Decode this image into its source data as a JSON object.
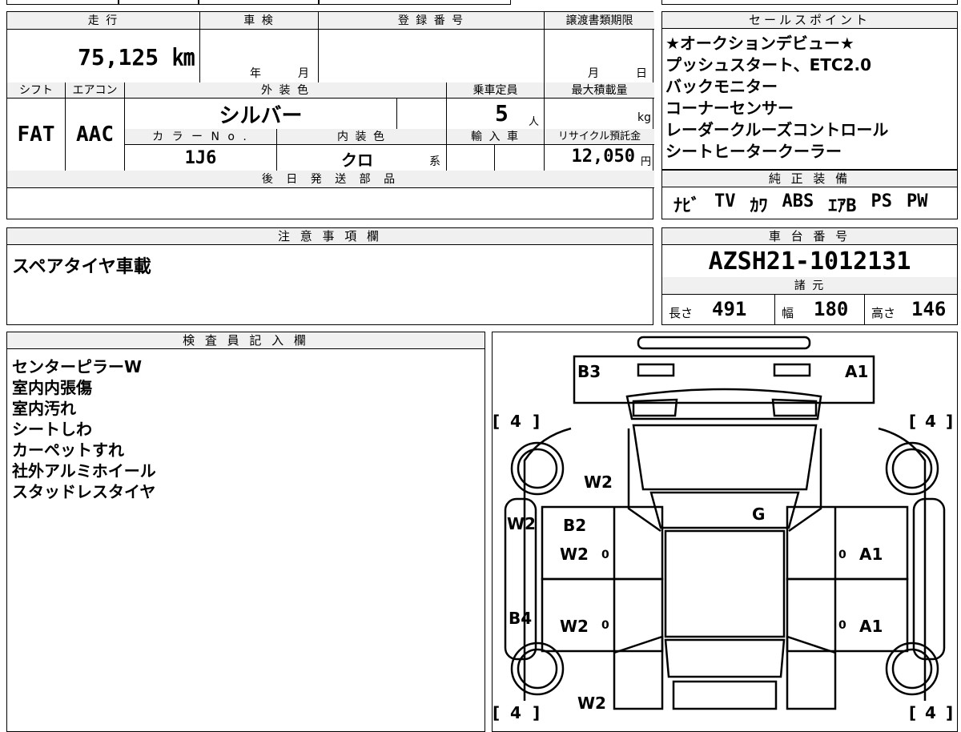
{
  "vehicle": {
    "mileage_label": "走 行",
    "mileage": "75,125 ㎞",
    "inspection_label": "車 検",
    "inspection_year": "年",
    "inspection_month": "月",
    "registration_label": "登 録 番 号",
    "deadline_label": "譲渡書類期限",
    "deadline_month": "月",
    "deadline_day": "日",
    "shift_label": "シフト",
    "shift": "FAT",
    "aircon_label": "エアコン",
    "aircon": "AAC",
    "exterior_color_label": "外 装 色",
    "exterior_color": "シルバー",
    "capacity_label": "乗車定員",
    "capacity": "5",
    "capacity_unit": "人",
    "max_load_label": "最大積載量",
    "max_load_unit": "kg",
    "color_no_label": "カ ラ ー N o .",
    "color_no": "1J6",
    "interior_color_label": "内 装 色",
    "interior_color": "クロ",
    "interior_color_suffix": "系",
    "import_label": "輸 入 車",
    "recycle_label": "リサイクル預託金",
    "recycle_fee": "12,050",
    "recycle_unit": "円",
    "later_parts_label": "後 日 発 送 部 品"
  },
  "sales_points": {
    "title": "セールスポイント",
    "items": [
      "★オークションデビュー★",
      "プッシュスタート、ETC2.0",
      "バックモニター",
      "コーナーセンサー",
      "レーダークルーズコントロール",
      "シートヒータークーラー"
    ]
  },
  "equipment": {
    "title": "純 正 装 備",
    "items": [
      "ﾅﾋﾞ",
      "TV",
      "ｶﾜ",
      "ABS",
      "ｴｱB",
      "PS",
      "PW"
    ]
  },
  "notes": {
    "title": "注 意 事 項 欄",
    "text": "スペアタイヤ車載"
  },
  "chassis": {
    "title": "車 台 番 号",
    "number": "AZSH21-1012131",
    "spec_title": "諸 元",
    "length_label": "長さ",
    "length": "491",
    "width_label": "幅",
    "width": "180",
    "height_label": "高さ",
    "height": "146"
  },
  "inspector": {
    "title": "検 査 員 記 入 欄",
    "items": [
      "センターピラーW",
      "室内内張傷",
      "室内汚れ",
      "シートしわ",
      "カーペットすれ",
      "社外アルミホイール",
      "スタッドレスタイヤ"
    ]
  },
  "diagram": {
    "marks": {
      "b3": "B3",
      "a1_top": "A1",
      "w2_hood": "W2",
      "g": "G",
      "w2_left": "W2",
      "b2": "B2",
      "w2_front_door": "W2",
      "a1_right_front": "A1",
      "b4": "B4",
      "w2_rear_door": "W2",
      "a1_right_rear": "A1",
      "w2_bottom": "W2",
      "tire_tl": "4",
      "tire_tr": "4",
      "tire_bl": "4",
      "tire_br": "4",
      "zero": "0"
    }
  }
}
